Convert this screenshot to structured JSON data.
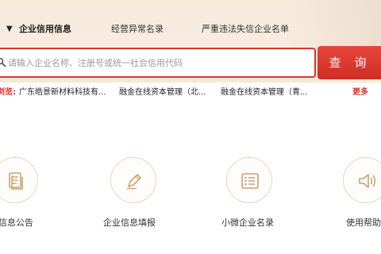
{
  "tabs": {
    "active": "企业信用信息",
    "items": [
      "经营异常名录",
      "严重违法失信企业名单"
    ]
  },
  "search": {
    "placeholder": "请输入企业名称、注册号或统一社会信用代码",
    "button_label": "查 询"
  },
  "recent": {
    "label": "浏览:",
    "items": [
      "广东皓景新材料科技有...",
      "融金在线资本管理（北...",
      "融金在线资本管理（青..."
    ],
    "more": "更多"
  },
  "features": [
    {
      "label": "信息公告",
      "icon": "document-icon"
    },
    {
      "label": "企业信息填报",
      "icon": "pen-icon"
    },
    {
      "label": "小微企业名录",
      "icon": "list-icon"
    },
    {
      "label": "使用帮助",
      "icon": "speaker-icon"
    }
  ],
  "colors": {
    "accent": "#d9342b",
    "icon_gold": "#c9a26a",
    "band": "#f6eadb"
  }
}
